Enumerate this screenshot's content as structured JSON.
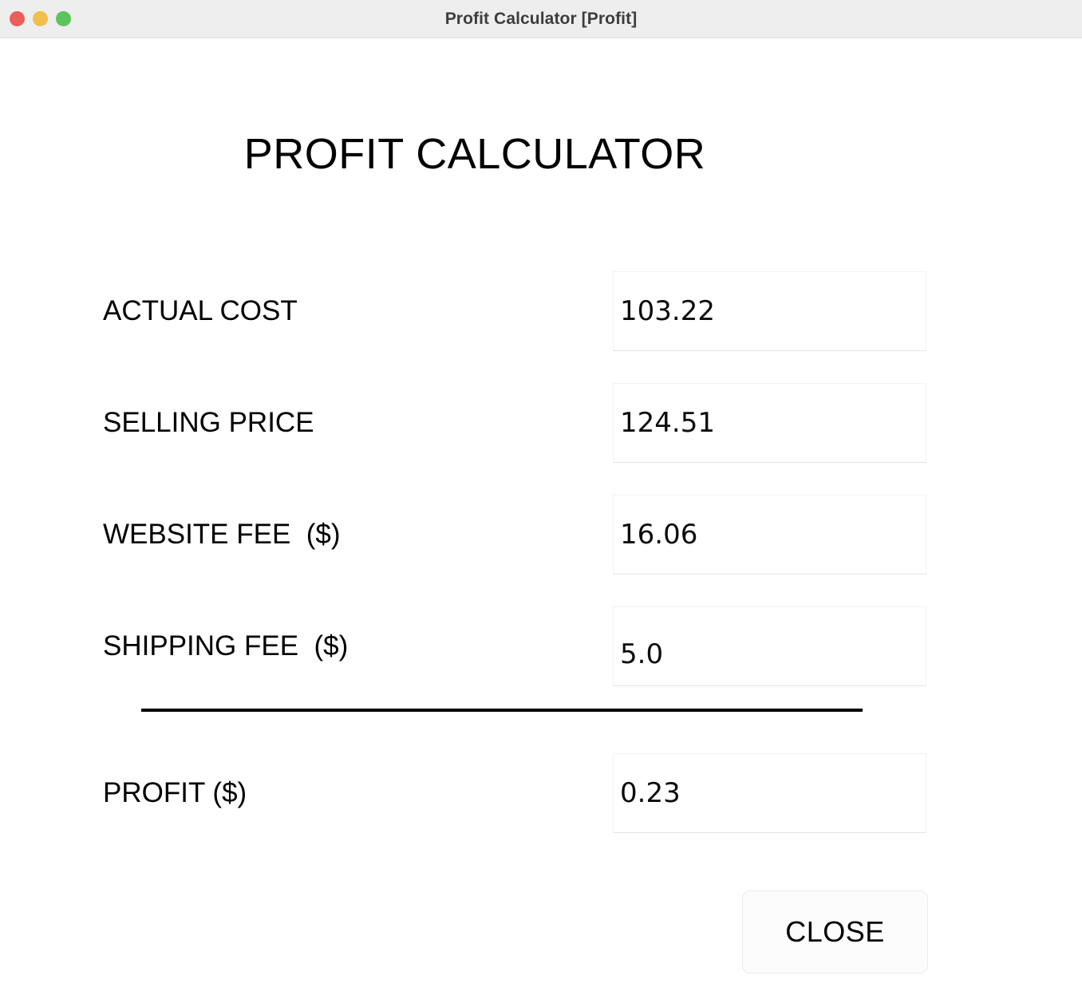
{
  "window": {
    "title": "Profit Calculator [Profit]",
    "controls": {
      "close_label": "close-button",
      "minimize_label": "minimize-button",
      "maximize_label": "maximize-button"
    },
    "colors": {
      "titlebar_bg": "#eeeeee",
      "traffic_red": "#e8605a",
      "traffic_yellow": "#f0bf4c",
      "traffic_green": "#5cc45a",
      "separator": "#000000",
      "field_border": "#f2f2f2"
    }
  },
  "heading": "PROFIT CALCULATOR",
  "fields": [
    {
      "label": "ACTUAL COST",
      "value": "103.22"
    },
    {
      "label": "SELLING PRICE",
      "value": "124.51"
    },
    {
      "label": "WEBSITE FEE  ($)",
      "value": "16.06"
    },
    {
      "label": "SHIPPING FEE  ($)",
      "value": "5.0"
    }
  ],
  "result": {
    "label": "PROFIT ($)",
    "value": "0.23"
  },
  "actions": {
    "close_label": "CLOSE"
  }
}
